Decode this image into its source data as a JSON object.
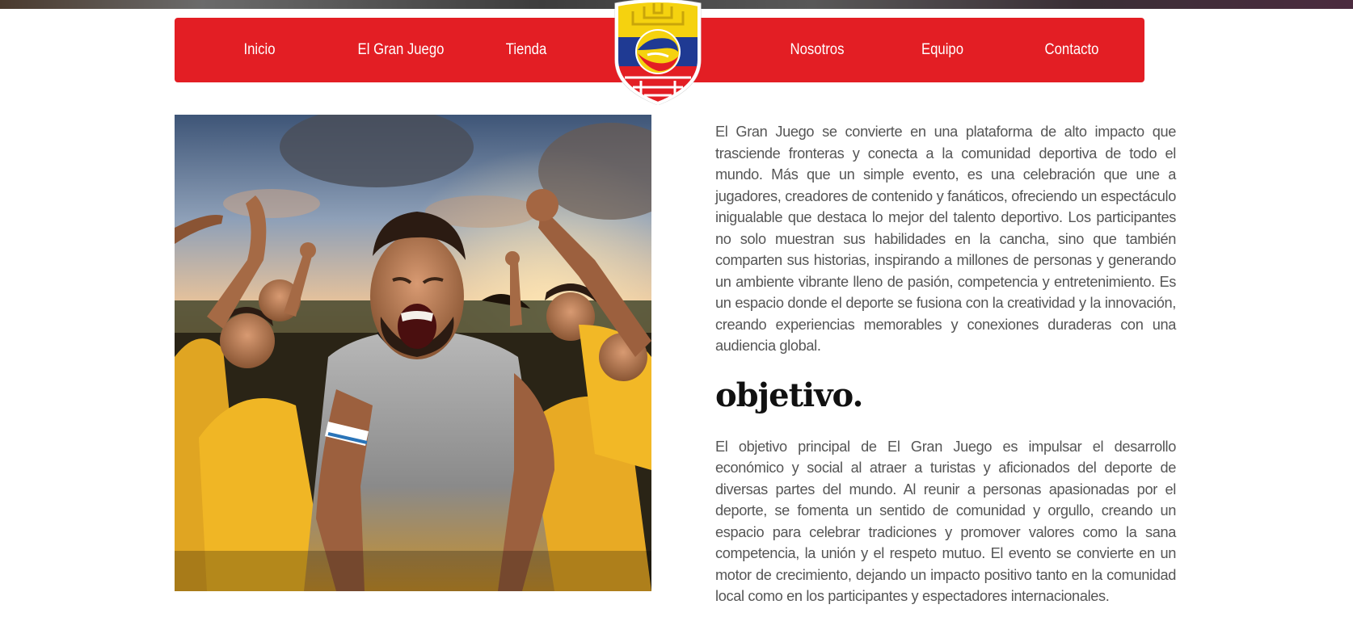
{
  "nav": {
    "items_left": [
      "Inicio",
      "El Gran Juego",
      "Tienda"
    ],
    "items_right": [
      "Nosotros",
      "Equipo",
      "Contacto"
    ],
    "background": "#e31e24",
    "text_color": "#ffffff"
  },
  "logo": {
    "icon": "shield-soccer-ball-icon",
    "colors": [
      "#f5d20f",
      "#1f3a93",
      "#e31e24"
    ]
  },
  "photo": {
    "icon": "celebrating-soccer-players-image"
  },
  "content": {
    "intro": "El Gran Juego se convierte en una plataforma de alto impacto que trasciende fronteras y conecta a la comunidad deportiva de todo el mundo. Más que un simple evento, es una celebración que une a jugadores, creadores de contenido y fanáticos, ofreciendo un espectáculo inigualable que destaca lo mejor del talento deportivo. Los participantes no solo muestran sus habilidades en la cancha, sino que también comparten sus historias, inspirando a millones de personas y generando un ambiente vibrante lleno de pasión, competencia y entretenimiento. Es un espacio donde el deporte se fusiona con la creatividad y la innovación, creando experiencias memorables y conexiones duraderas con una audiencia global.",
    "objective_title": "objetivo.",
    "objective_text": "El objetivo principal de El Gran Juego es impulsar el desarrollo económico y social al atraer a turistas y aficionados del deporte de diversas partes del mundo. Al reunir a personas apasionadas por el deporte, se fomenta un sentido de comunidad y orgullo, creando un espacio para celebrar tradiciones y promover valores como la sana competencia, la unión y el respeto mutuo. El evento se convierte en un motor de crecimiento, dejando un impacto positivo tanto en la comunidad local como en los participantes y espectadores internacionales."
  }
}
